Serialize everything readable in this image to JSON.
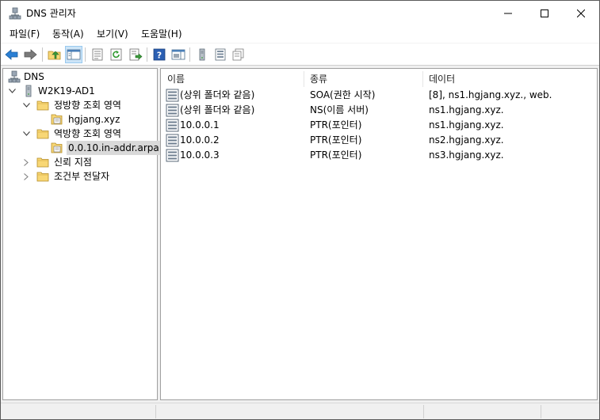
{
  "window": {
    "title": "DNS 관리자",
    "buttons": {
      "minimize": "minimize",
      "maximize": "maximize",
      "close": "close"
    }
  },
  "menu": [
    {
      "label": "파일(F)"
    },
    {
      "label": "동작(A)"
    },
    {
      "label": "보기(V)"
    },
    {
      "label": "도움말(H)"
    }
  ],
  "toolbar": {
    "icons": [
      "back-icon",
      "forward-icon",
      "up-folder-icon",
      "show-hide-tree-icon",
      "properties-icon",
      "refresh-icon",
      "export-list-icon",
      "help-icon",
      "show-pane-icon",
      "server-icon",
      "records-icon",
      "copy-icon"
    ]
  },
  "tree": {
    "root": "DNS",
    "server": "W2K19-AD1",
    "forward_zones": "정방향 조회 영역",
    "forward_zone_item": "hgjang.xyz",
    "reverse_zones": "역방향 조회 영역",
    "reverse_zone_item": "0.0.10.in-addr.arpa",
    "trust_points": "신뢰 지점",
    "conditional_forwarders": "조건부 전달자"
  },
  "list": {
    "columns": [
      "이름",
      "종류",
      "데이터"
    ],
    "rows": [
      {
        "name": "(상위 폴더와 같음)",
        "type": "SOA(권한 시작)",
        "data": "[8], ns1.hgjang.xyz., web."
      },
      {
        "name": "(상위 폴더와 같음)",
        "type": "NS(이름 서버)",
        "data": "ns1.hgjang.xyz."
      },
      {
        "name": "10.0.0.1",
        "type": "PTR(포인터)",
        "data": "ns1.hgjang.xyz."
      },
      {
        "name": "10.0.0.2",
        "type": "PTR(포인터)",
        "data": "ns2.hgjang.xyz."
      },
      {
        "name": "10.0.0.3",
        "type": "PTR(포인터)",
        "data": "ns3.hgjang.xyz."
      }
    ]
  },
  "colors": {
    "selection": "#d9d9d9",
    "folder": "#f8d775",
    "toolbar_pressed": "#cce4f7",
    "arrow_blue": "#2a7fd4"
  }
}
